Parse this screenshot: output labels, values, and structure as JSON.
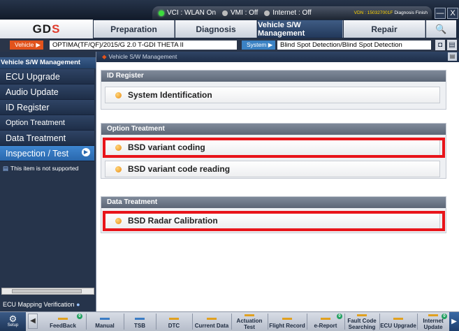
{
  "status": {
    "vci": "VCI : WLAN On",
    "vmi": "VMI : Off",
    "internet": "Internet : Off",
    "vdn_label": "VDN : 150327001F",
    "vdn_state": "Diagnosis Finish"
  },
  "window": {
    "minimize": "—",
    "close": "X"
  },
  "logo": {
    "text_a": "GD",
    "text_b": "S"
  },
  "menu": {
    "items": [
      {
        "label": "Preparation"
      },
      {
        "label": "Diagnosis"
      },
      {
        "label": "Vehicle S/W Management"
      },
      {
        "label": "Repair"
      }
    ],
    "search_icon": "🔍"
  },
  "vehicle": {
    "tag": "Vehicle",
    "value": "OPTIMA(TF/QF)/2015/G 2.0 T-GDI THETA II",
    "system_tag": "System",
    "system_value": "Blind Spot Detection/Blind Spot Detection"
  },
  "sidebar": {
    "header": "Vehicle S/W Management",
    "items": [
      {
        "label": "ECU Upgrade"
      },
      {
        "label": "Audio Update"
      },
      {
        "label": "ID Register"
      },
      {
        "label": "Option Treatment"
      },
      {
        "label": "Data Treatment"
      },
      {
        "label": "Inspection / Test"
      }
    ],
    "notice": "This item is not supported",
    "scroll_label": "III",
    "ecu_mapping": "ECU Mapping Verification"
  },
  "breadcrumb": "Vehicle S/W Management",
  "groups": [
    {
      "title": "ID Register",
      "items": [
        {
          "label": "System Identification"
        }
      ]
    },
    {
      "title": "Option Treatment",
      "items": [
        {
          "label": "BSD variant coding"
        },
        {
          "label": "BSD variant code reading"
        }
      ]
    },
    {
      "title": "Data Treatment",
      "items": [
        {
          "label": "BSD Radar Calibration"
        }
      ]
    }
  ],
  "toolbar": {
    "setup": "Setup",
    "items": [
      {
        "label": "FeedBack"
      },
      {
        "label": "Manual"
      },
      {
        "label": "TSB"
      },
      {
        "label": "DTC"
      },
      {
        "label": "Current Data"
      },
      {
        "label": "Actuation Test"
      },
      {
        "label": "Flight Record"
      },
      {
        "label": "e-Report"
      },
      {
        "label": "Fault Code Searching"
      },
      {
        "label": "ECU Upgrade"
      },
      {
        "label": "Internet Update"
      }
    ],
    "badge": "0"
  },
  "colors": {
    "highlight": "#e8141a",
    "accent": "#e2531c",
    "selected": "#2a68ad"
  }
}
